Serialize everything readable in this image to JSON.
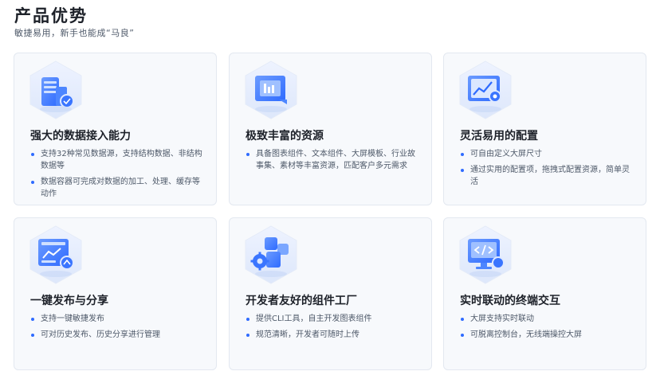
{
  "header": {
    "title": "产品优势",
    "subtitle": "敏捷易用，新手也能成“马良”"
  },
  "cards": [
    {
      "title": "强大的数据接入能力",
      "icon": "database-icon",
      "points": [
        "支持32种常见数据源，支持结构数据、非结构数据等",
        "数据容器可完成对数据的加工、处理、缓存等动作"
      ]
    },
    {
      "title": "极致丰富的资源",
      "icon": "resource-window-icon",
      "points": [
        "具备图表组件、文本组件、大屏模板、行业故事集、素材等丰富资源，匹配客户多元需求"
      ]
    },
    {
      "title": "灵活易用的配置",
      "icon": "config-chart-icon",
      "points": [
        "可自由定义大屏尺寸",
        "通过实用的配置项，拖拽式配置资源，简单灵活"
      ]
    },
    {
      "title": "一键发布与分享",
      "icon": "publish-share-icon",
      "points": [
        "支持一键敏捷发布",
        "可对历史发布、历史分享进行管理"
      ]
    },
    {
      "title": "开发者友好的组件工厂",
      "icon": "component-factory-icon",
      "points": [
        "提供CLI工具，自主开发图表组件",
        "规范清晰，开发者可随时上传"
      ]
    },
    {
      "title": "实时联动的终端交互",
      "icon": "terminal-code-icon",
      "points": [
        "大屏支持实时联动",
        "可脱离控制台，无线端操控大屏"
      ]
    }
  ],
  "colors": {
    "accent": "#2f6bff",
    "card_bg": "#f7f9fc",
    "card_border": "#e3e8f0",
    "text_primary": "#1d2129",
    "text_secondary": "#4e5969"
  }
}
